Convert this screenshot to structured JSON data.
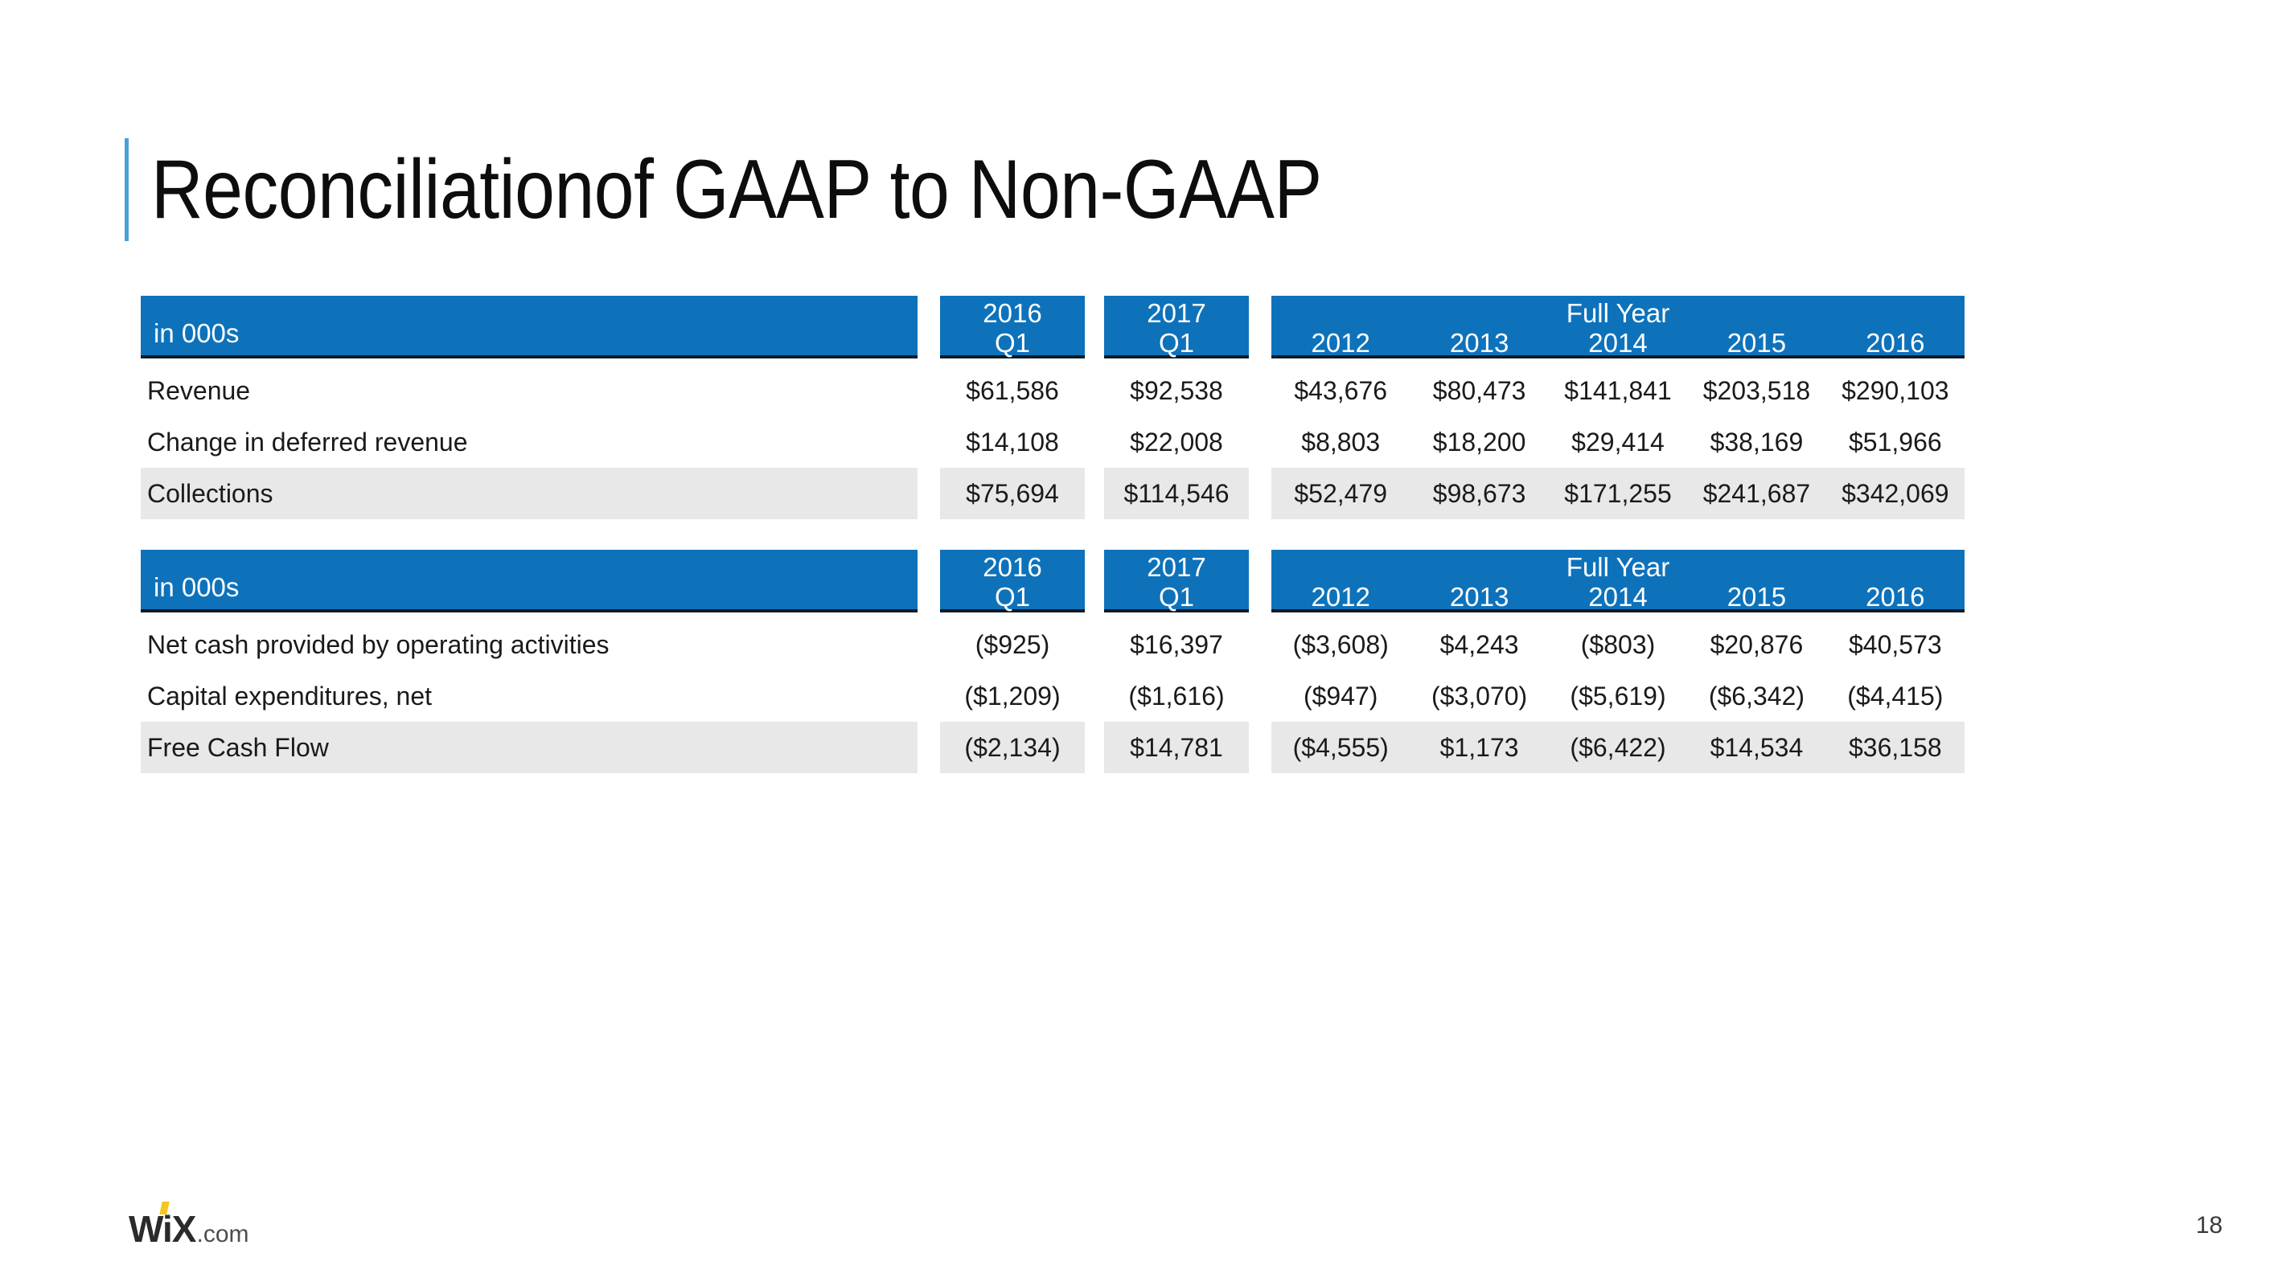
{
  "slide": {
    "title": "Reconciliationof GAAP to Non-GAAP",
    "page_number": "18",
    "accent_color": "#4a9fdc",
    "header_color": "#0e72bb",
    "shaded_row_color": "#e8e8e8"
  },
  "logo": {
    "mark": "WiX",
    "suffix": ".com",
    "dot_color": "#f5c521"
  },
  "tables": [
    {
      "label_header": "in 000s",
      "quarter_columns": [
        {
          "year": "2016",
          "period": "Q1"
        },
        {
          "year": "2017",
          "period": "Q1"
        }
      ],
      "full_year_title": "Full Year",
      "full_year_columns": [
        "2012",
        "2013",
        "2014",
        "2015",
        "2016"
      ],
      "rows": [
        {
          "label": "Revenue",
          "shaded": false,
          "quarters": [
            "$61,586",
            "$92,538"
          ],
          "full_year": [
            "$43,676",
            "$80,473",
            "$141,841",
            "$203,518",
            "$290,103"
          ]
        },
        {
          "label": "Change in deferred revenue",
          "shaded": false,
          "quarters": [
            "$14,108",
            "$22,008"
          ],
          "full_year": [
            "$8,803",
            "$18,200",
            "$29,414",
            "$38,169",
            "$51,966"
          ]
        },
        {
          "label": "Collections",
          "shaded": true,
          "quarters": [
            "$75,694",
            "$114,546"
          ],
          "full_year": [
            "$52,479",
            "$98,673",
            "$171,255",
            "$241,687",
            "$342,069"
          ]
        }
      ]
    },
    {
      "label_header": "in 000s",
      "quarter_columns": [
        {
          "year": "2016",
          "period": "Q1"
        },
        {
          "year": "2017",
          "period": "Q1"
        }
      ],
      "full_year_title": "Full Year",
      "full_year_columns": [
        "2012",
        "2013",
        "2014",
        "2015",
        "2016"
      ],
      "rows": [
        {
          "label": "Net cash provided by operating activities",
          "shaded": false,
          "quarters": [
            "($925)",
            "$16,397"
          ],
          "full_year": [
            "($3,608)",
            "$4,243",
            "($803)",
            "$20,876",
            "$40,573"
          ]
        },
        {
          "label": "Capital expenditures, net",
          "shaded": false,
          "quarters": [
            "($1,209)",
            "($1,616)"
          ],
          "full_year": [
            "($947)",
            "($3,070)",
            "($5,619)",
            "($6,342)",
            "($4,415)"
          ]
        },
        {
          "label": "Free Cash Flow",
          "shaded": true,
          "quarters": [
            "($2,134)",
            "$14,781"
          ],
          "full_year": [
            "($4,555)",
            "$1,173",
            "($6,422)",
            "$14,534",
            "$36,158"
          ]
        }
      ]
    }
  ]
}
